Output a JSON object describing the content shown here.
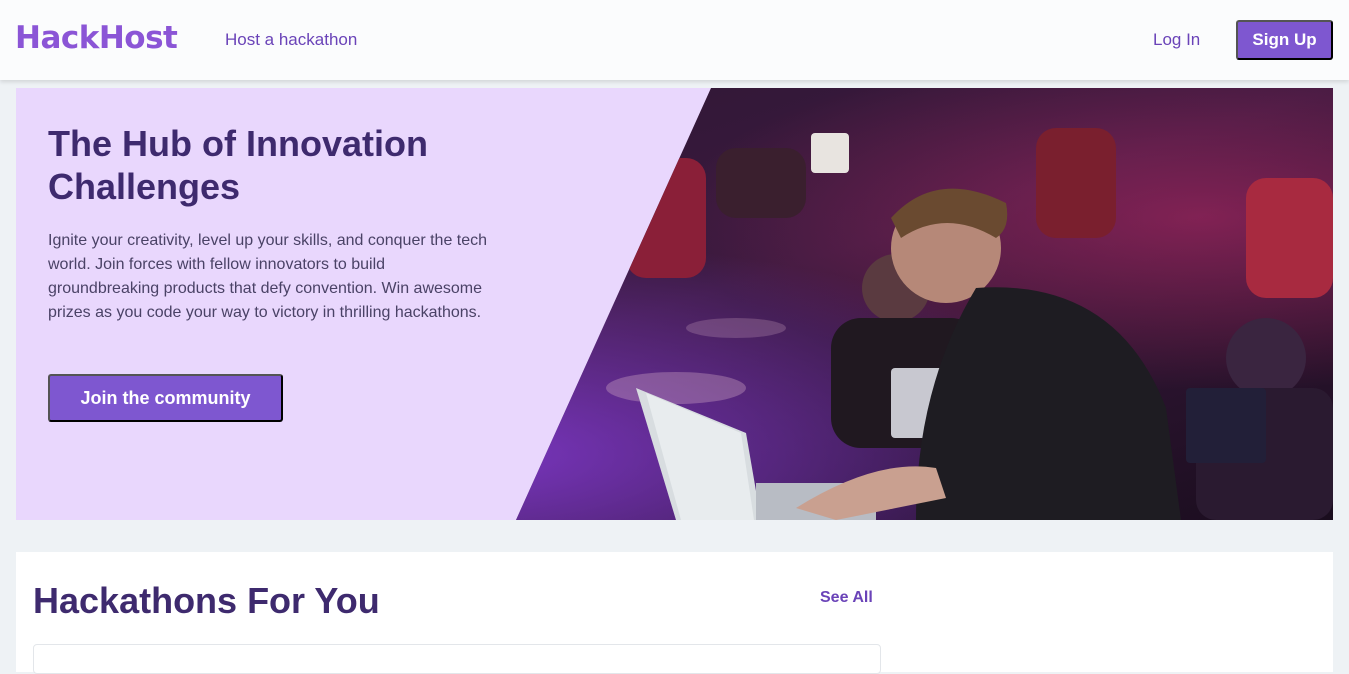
{
  "header": {
    "logo": "HackHost",
    "nav_link": "Host a hackathon",
    "login": "Log In",
    "signup": "Sign Up"
  },
  "hero": {
    "title": "The Hub of Innovation Challenges",
    "description": "Ignite your creativity, level up your skills, and conquer the tech world. Join forces with fellow innovators to build groundbreaking products that defy convention. Win awesome prizes as you code your way to victory in thrilling hackathons.",
    "cta": "Join the community"
  },
  "section": {
    "title": "Hackathons For You",
    "see_all": "See All"
  },
  "colors": {
    "brand": "#8b55d6",
    "button": "#7e57d0",
    "text_dark": "#3e2a6e",
    "hero_bg": "#e9d7fd"
  }
}
